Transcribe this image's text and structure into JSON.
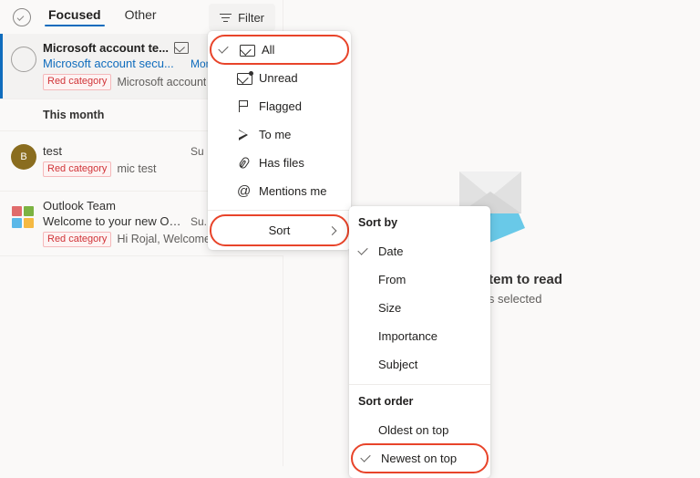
{
  "list_pane": {
    "select_all_icon": "circle-check-icon",
    "tabs": [
      {
        "label": "Focused",
        "active": true
      },
      {
        "label": "Other",
        "active": false
      }
    ],
    "filter_button": {
      "label": "Filter",
      "icon": "filter-icon"
    },
    "group_header": "This month",
    "messages": [
      {
        "avatar_type": "hollow-circle",
        "avatar_text": "",
        "avatar_color": "",
        "sender": "Microsoft account te...",
        "sender_bold": true,
        "unread_icon": "envelope-icon",
        "subject": "Microsoft account secu...",
        "subject_link": true,
        "date": "Mon",
        "date_link": true,
        "category": "Red category",
        "preview": "Microsoft account ",
        "selected": true
      },
      {
        "avatar_type": "initial",
        "avatar_text": "B",
        "avatar_color": "#8a6d1f",
        "sender": "test",
        "sender_bold": false,
        "unread_icon": "",
        "subject": "",
        "subject_link": false,
        "date": "Su",
        "date_link": false,
        "category": "Red category",
        "preview": "mic test",
        "selected": false
      },
      {
        "avatar_type": "ms-logo",
        "avatar_text": "",
        "avatar_color": "",
        "sender": "Outlook Team",
        "sender_bold": false,
        "unread_icon": "",
        "subject": "Welcome to your new Ou...",
        "subject_link": false,
        "date": "Su.",
        "date_link": false,
        "category": "Red category",
        "preview": "Hi Rojal, Welcome to you...",
        "selected": false
      }
    ]
  },
  "reading_pane": {
    "illustration": "empty-envelope-illustration",
    "title": "Select an item to read",
    "subtitle": "Nothing is selected"
  },
  "filter_menu": {
    "items": [
      {
        "label": "All",
        "icon": "envelope-icon",
        "checked": true,
        "highlighted": true
      },
      {
        "label": "Unread",
        "icon": "envelope-dot-icon",
        "checked": false,
        "highlighted": false
      },
      {
        "label": "Flagged",
        "icon": "flag-icon",
        "checked": false,
        "highlighted": false
      },
      {
        "label": "To me",
        "icon": "send-arrow-icon",
        "checked": false,
        "highlighted": false
      },
      {
        "label": "Has files",
        "icon": "paperclip-icon",
        "checked": false,
        "highlighted": false
      },
      {
        "label": "Mentions me",
        "icon": "at-sign-icon",
        "checked": false,
        "highlighted": false
      }
    ],
    "sort_row": {
      "label": "Sort",
      "chevron_icon": "chevron-right-icon",
      "highlighted": true
    }
  },
  "sort_menu": {
    "sort_by_title": "Sort by",
    "sort_by_items": [
      {
        "label": "Date",
        "checked": true,
        "highlighted": false
      },
      {
        "label": "From",
        "checked": false,
        "highlighted": false
      },
      {
        "label": "Size",
        "checked": false,
        "highlighted": false
      },
      {
        "label": "Importance",
        "checked": false,
        "highlighted": false
      },
      {
        "label": "Subject",
        "checked": false,
        "highlighted": false
      }
    ],
    "sort_order_title": "Sort order",
    "sort_order_items": [
      {
        "label": "Oldest on top",
        "checked": false,
        "highlighted": false
      },
      {
        "label": "Newest on top",
        "checked": true,
        "highlighted": true
      }
    ]
  },
  "colors": {
    "accent": "#0f6cbd",
    "highlight_outline": "#e8442a",
    "category_red": "#d13438",
    "page_bg": "#faf9f8",
    "selected_row": "#f3f2f1"
  }
}
